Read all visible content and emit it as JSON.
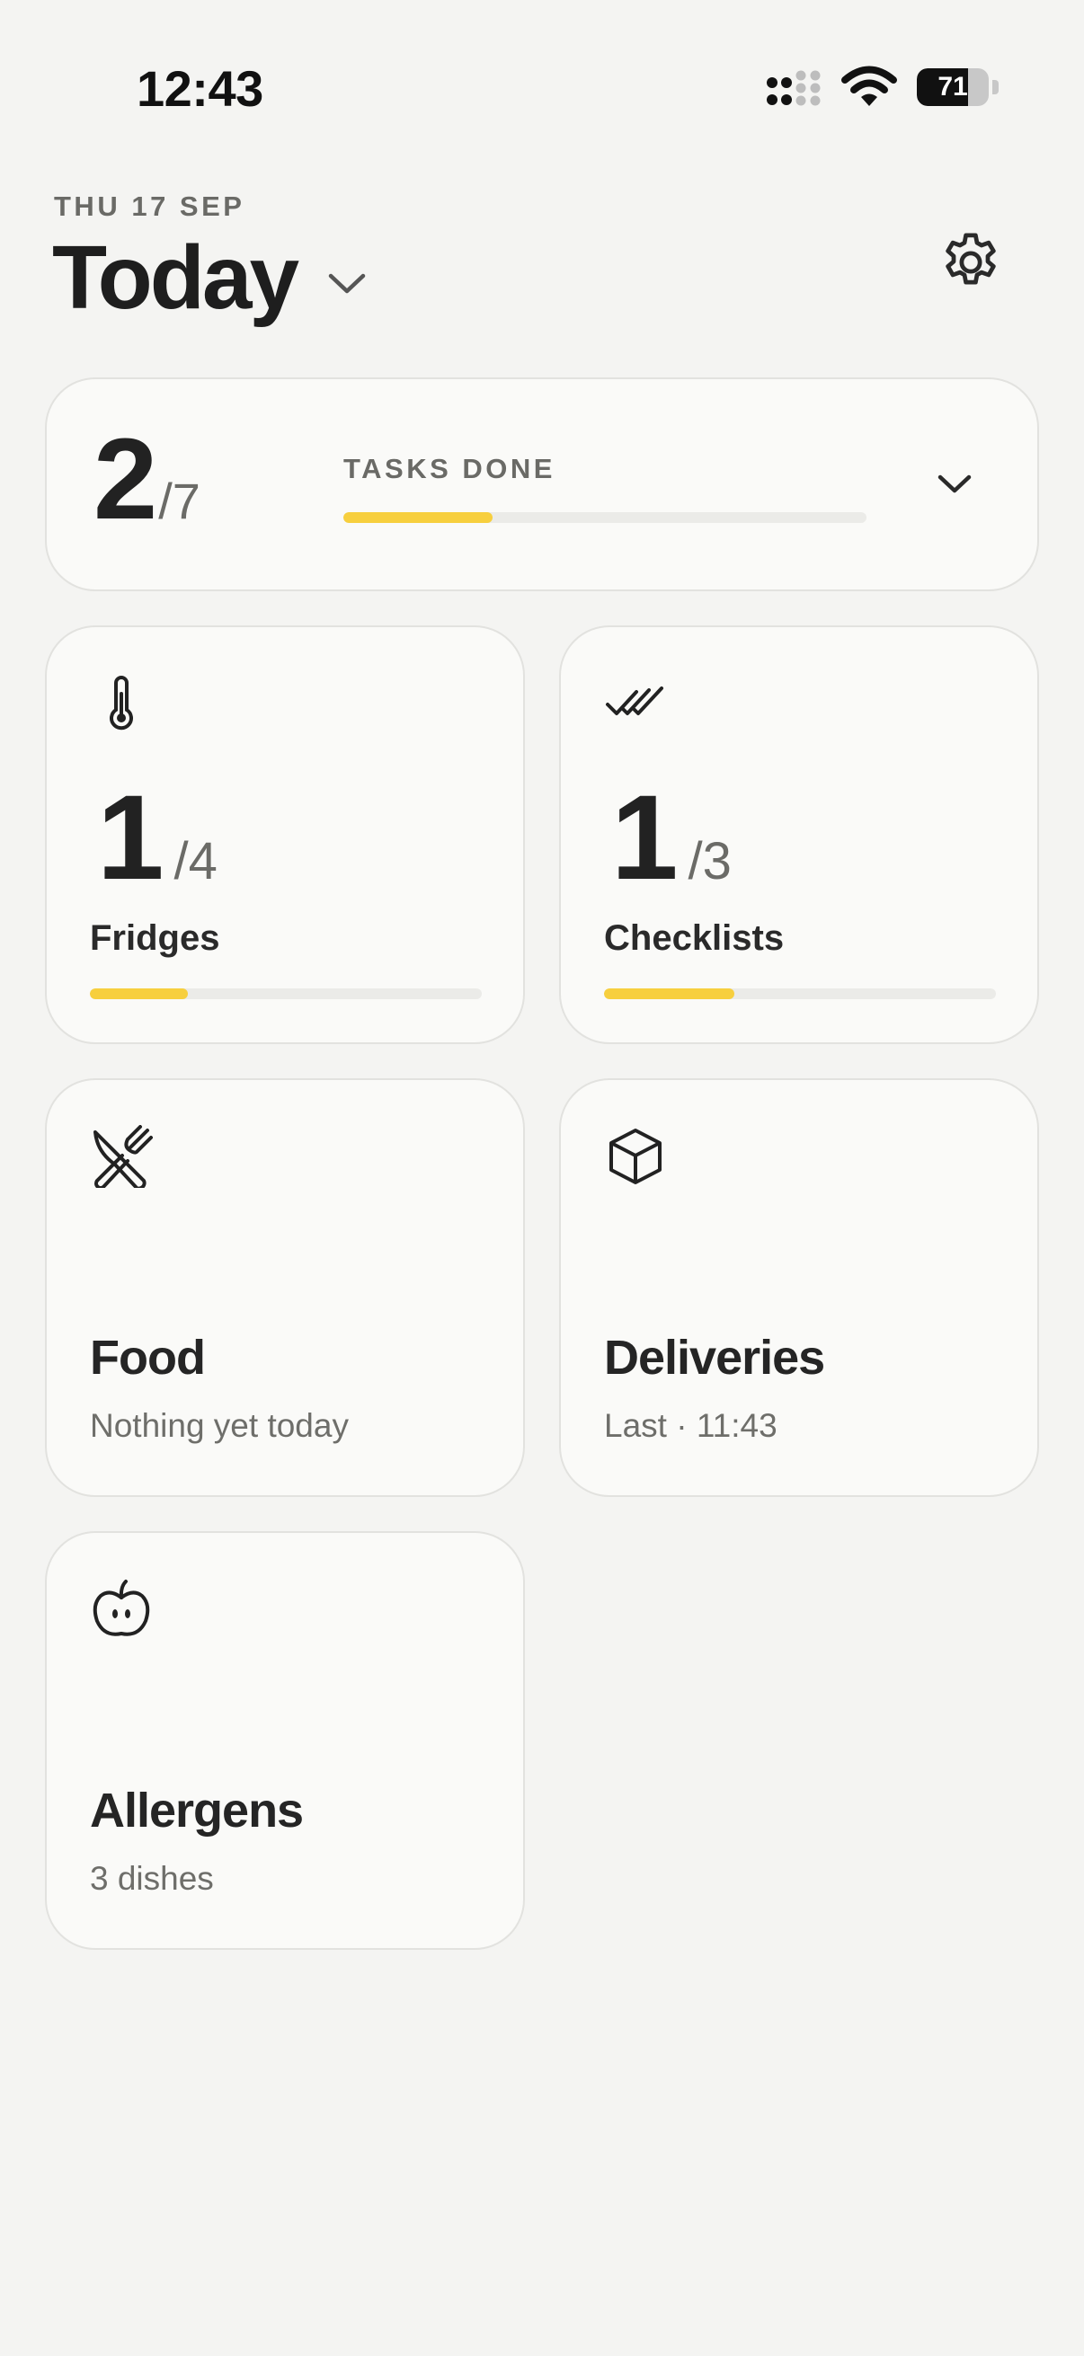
{
  "status_bar": {
    "time": "12:43",
    "battery_level": 71,
    "battery_label": "71",
    "icons": [
      "cellular-signal-icon",
      "wifi-icon",
      "battery-icon"
    ]
  },
  "header": {
    "date": "THU 17 SEP",
    "title": "Today",
    "icons": [
      "chevron-down-icon",
      "gear-icon"
    ]
  },
  "summary": {
    "done": "2",
    "total": "/7",
    "label": "TASKS DONE",
    "progress": 0.2857,
    "icon": "chevron-down-icon"
  },
  "tiles": [
    {
      "name": "Fridges",
      "icon": "thermometer-icon",
      "done": "1",
      "total": "/4",
      "progress": 0.25
    },
    {
      "name": "Checklists",
      "icon": "double-check-icon",
      "done": "1",
      "total": "/3",
      "progress": 0.333
    },
    {
      "name": "Food",
      "icon": "cutlery-icon",
      "subtitle": "Nothing yet today"
    },
    {
      "name": "Deliveries",
      "icon": "box-icon",
      "subtitle": "Last · 11:43"
    },
    {
      "name": "Allergens",
      "icon": "apple-icon",
      "subtitle": "3 dishes"
    }
  ],
  "colors": {
    "background": "#f4f4f2",
    "card": "#fafaf8",
    "accent": "#f7cf3e",
    "text": "#222222",
    "muted": "#6a6a66"
  }
}
